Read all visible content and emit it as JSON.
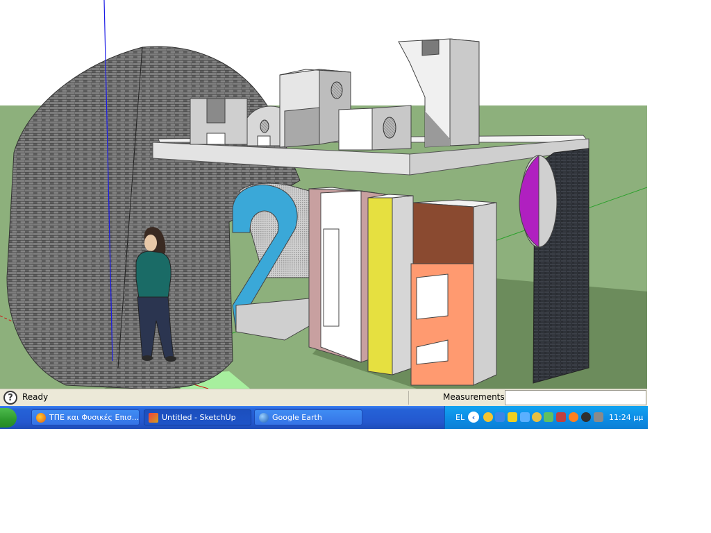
{
  "status_bar": {
    "help_icon": "question-mark-icon",
    "help_glyph": "?",
    "status_text": "Ready",
    "measurements_label": "Measurements",
    "measurements_value": ""
  },
  "taskbar": {
    "buttons": [
      {
        "label": "ΤΠΕ και Φυσικές Επισ...",
        "icon": "firefox-icon",
        "active": false
      },
      {
        "label": "Untitled - SketchUp",
        "icon": "sketchup-icon",
        "active": true
      },
      {
        "label": "Google Earth",
        "icon": "google-earth-icon",
        "active": false
      }
    ],
    "language": "EL",
    "tray_arrow": "‹",
    "clock": "11:24 μμ"
  },
  "colors": {
    "sky": "#ffffff",
    "grass": "#8db07c",
    "shadow": "#6c8c5c",
    "taskbar": "#2458cf",
    "tray": "#0d8ee6"
  }
}
